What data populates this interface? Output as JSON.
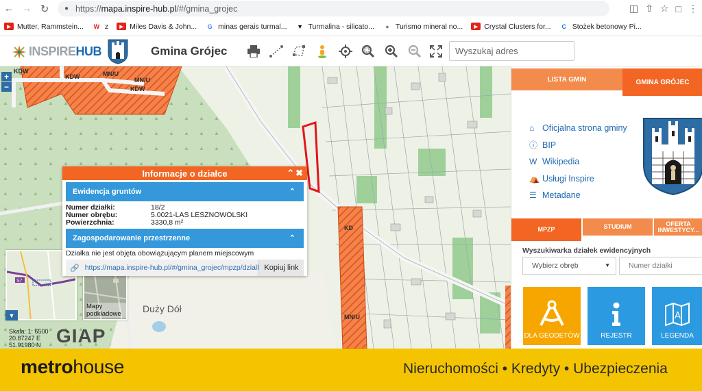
{
  "browser": {
    "url_scheme": "https://",
    "url_host": "mapa.inspire-hub.pl",
    "url_path": "/#/gmina_grojec"
  },
  "bookmarks": [
    {
      "label": "Mutter, Rammstein...",
      "icon": "youtube-icon",
      "color": "#e62117"
    },
    {
      "label": "z",
      "icon": "wp-icon",
      "color": "#e62117"
    },
    {
      "label": "Miles Davis & John...",
      "icon": "youtube-icon",
      "color": "#e62117"
    },
    {
      "label": "minas gerais turmal...",
      "icon": "google-icon",
      "color": "#4285f4"
    },
    {
      "label": "Turmalina - silicato...",
      "icon": "wolf-icon",
      "color": "#111111"
    },
    {
      "label": "Turismo mineral no...",
      "icon": "globe-icon",
      "color": "#888888"
    },
    {
      "label": "Crystal Clusters for...",
      "icon": "youtube-icon",
      "color": "#e62117"
    },
    {
      "label": "Stożek betonowy Pi...",
      "icon": "c-icon",
      "color": "#1a73e8"
    }
  ],
  "app": {
    "logo_part1": "INSPIRE",
    "logo_part2": "HUB",
    "title": "Gmina Grójec",
    "search_placeholder": "Wyszukaj adres"
  },
  "map": {
    "zoom_in": "+",
    "zoom_out": "−",
    "labels": {
      "kdw1": "KDW",
      "kdw2": "KDW",
      "kdw3": "KDW",
      "mnu1": "MN/U",
      "mnu2": "MN/U",
      "mnu3": "MN/U",
      "kd": "KD",
      "duzy_dol": "Duży Dół"
    },
    "ortho_label": "Mapy podkładowe",
    "scale": "Skala: 1: 6500",
    "lon": "20.87247 E",
    "lat": "51.91980 N",
    "giap": "GIAP"
  },
  "popup": {
    "title": "Informacje o działce",
    "section1": "Ewidencja gruntów",
    "rows": [
      {
        "k": "Numer działki:",
        "v": "18/2"
      },
      {
        "k": "Numer obrębu:",
        "v": "5.0021-LAS LESZNOWOLSKI"
      },
      {
        "k": "Powierzchnia:",
        "v": "3330,8 m²"
      }
    ],
    "section2": "Zagospodarowanie przestrzenne",
    "note": "Działka nie jest objęta obowiązującym planem miejscowym",
    "link": "https://mapa.inspire-hub.pl/#/gmina_grojec/mpzp/dzialka...",
    "copy_label": "Kopiuj link"
  },
  "panel": {
    "tab_lista": "LISTA GMIN",
    "tab_gmina": "GMINA GRÓJEC",
    "links": [
      {
        "label": "Oficjalna strona gminy",
        "icon": "home-icon"
      },
      {
        "label": "BIP",
        "icon": "info-icon"
      },
      {
        "label": "Wikipedia",
        "icon": "wikipedia-icon"
      },
      {
        "label": "Usługi Inspire",
        "icon": "institution-icon"
      },
      {
        "label": "Metadane",
        "icon": "database-icon"
      }
    ],
    "subtabs": [
      "MPZP",
      "STUDIUM",
      "OFERTA INWESTYCY..."
    ],
    "finder_title": "Wyszukiwarka działek ewidencyjnych",
    "select_obreb": "Wybierz obręb",
    "input_dzialka_placeholder": "Numer działki",
    "tiles": [
      {
        "label": "DLA GEODETÓW",
        "icon": "compass-icon"
      },
      {
        "label": "REJESTR",
        "icon": "info-icon"
      },
      {
        "label": "LEGENDA",
        "icon": "map-legend-icon"
      }
    ]
  },
  "banner": {
    "brand_bold": "metro",
    "brand_regular": "house",
    "slogan": "Nieruchomości • Kredyty • Ubezpieczenia"
  },
  "colors": {
    "orange": "#f26522",
    "blue": "#3498db",
    "banner": "#f5c400"
  }
}
